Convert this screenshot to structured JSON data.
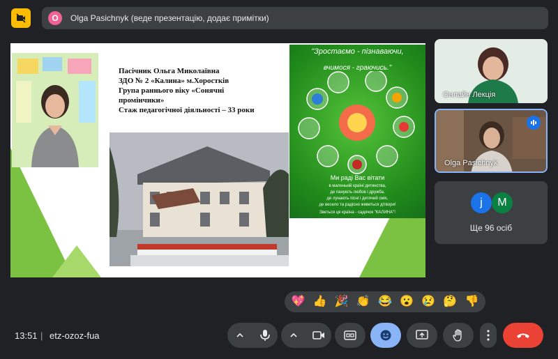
{
  "top_bar": {
    "presenter_initial": "O",
    "presenter_text": "Olga Pasichnyk (веде презентацію, додає примітки)"
  },
  "slide": {
    "bio_lines": [
      "Пасічник Ольга Миколаївна",
      "ЗДО № 2 «Калина» м.Хоростків",
      "Група раннього віку «Сонячні",
      "промінчики»",
      "Стаж педагогічної діяльності – 33 роки"
    ],
    "poster": {
      "heading": "\"Зростаємо - пізнаваючи,",
      "heading2": "вчимося - граючись.\"",
      "greeting": "Ми раді Вас вітати",
      "lines": [
        "в маленькій країні дитинства,",
        "де панують любов і дружба,",
        "де лунають пісні і дитячий сміх,",
        "де весело та радісно живеться дітвори!",
        "Зветься ця країна - садочок   \"КАЛИНА\"!"
      ]
    }
  },
  "participants": [
    {
      "name": "Онлайн Лекція"
    },
    {
      "name": "Olga Pasichnyk"
    }
  ],
  "more": {
    "avatars": [
      {
        "letter": "j",
        "color": "#1a73e8"
      },
      {
        "letter": "M",
        "color": "#0b8043"
      }
    ],
    "label": "Ще 96 осіб"
  },
  "reactions": [
    "💖",
    "👍",
    "🎉",
    "👏",
    "😂",
    "😮",
    "😢",
    "🤔",
    "👎"
  ],
  "bottom_bar": {
    "time": "13:51",
    "separator": "|",
    "meeting_code": "etz-ozoz-fua"
  },
  "colors": {
    "accent_blue": "#8ab4f8",
    "end_call_red": "#ea4335",
    "camera_off_yellow": "#fbbc04"
  }
}
